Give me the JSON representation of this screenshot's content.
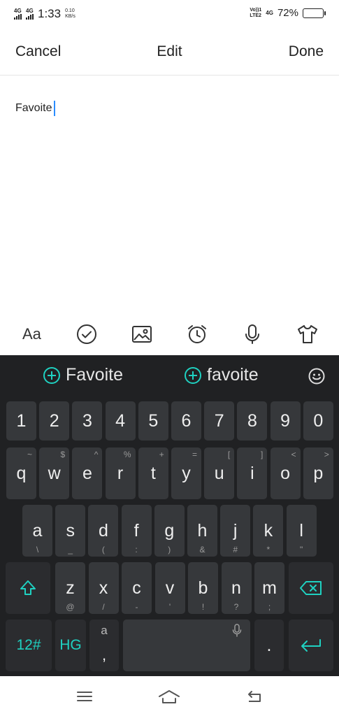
{
  "status_bar": {
    "net1": "4G",
    "net2": "4G",
    "time": "1:33",
    "speed_value": "0.10",
    "speed_unit": "KB/s",
    "volte_top": "Vo))1",
    "volte_bottom": "LTE2",
    "net_right": "4G",
    "battery_percent": "72%",
    "battery_level": 72,
    "battery_color": "#f5b400"
  },
  "header": {
    "cancel_label": "Cancel",
    "title": "Edit",
    "done_label": "Done"
  },
  "editor": {
    "text": "Favoite"
  },
  "toolbar": {
    "items": [
      "font-size-icon",
      "checkbox-icon",
      "image-icon",
      "alarm-icon",
      "microphone-icon",
      "theme-shirt-icon"
    ],
    "font_label": "Aa"
  },
  "keyboard": {
    "accent_color": "#1fd1c1",
    "suggestions": [
      "Favoite",
      "favoite"
    ],
    "number_row": [
      "1",
      "2",
      "3",
      "4",
      "5",
      "6",
      "7",
      "8",
      "9",
      "0"
    ],
    "row1": [
      {
        "k": "q",
        "s": "~"
      },
      {
        "k": "w",
        "s": "$"
      },
      {
        "k": "e",
        "s": "^"
      },
      {
        "k": "r",
        "s": "%"
      },
      {
        "k": "t",
        "s": "+"
      },
      {
        "k": "y",
        "s": "="
      },
      {
        "k": "u",
        "s": "["
      },
      {
        "k": "i",
        "s": "]"
      },
      {
        "k": "o",
        "s": "<"
      },
      {
        "k": "p",
        "s": ">"
      }
    ],
    "row2": [
      {
        "k": "a",
        "s": "\\"
      },
      {
        "k": "s",
        "s": "_"
      },
      {
        "k": "d",
        "s": "("
      },
      {
        "k": "f",
        "s": ":"
      },
      {
        "k": "g",
        "s": ")"
      },
      {
        "k": "h",
        "s": "&"
      },
      {
        "k": "j",
        "s": "#"
      },
      {
        "k": "k",
        "s": "*"
      },
      {
        "k": "l",
        "s": "\""
      }
    ],
    "row3": [
      {
        "k": "z",
        "s": "@"
      },
      {
        "k": "x",
        "s": "/"
      },
      {
        "k": "c",
        "s": "-"
      },
      {
        "k": "v",
        "s": "'"
      },
      {
        "k": "b",
        "s": "!"
      },
      {
        "k": "n",
        "s": "?"
      },
      {
        "k": "m",
        "s": ";"
      }
    ],
    "symbols_label": "12#",
    "lang_label": "HG",
    "comma_top": "a",
    "comma_label": ",",
    "period_label": "."
  }
}
